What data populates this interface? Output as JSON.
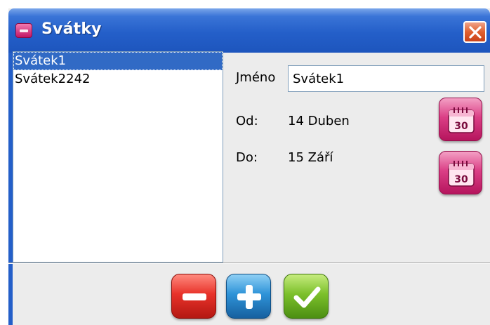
{
  "window": {
    "title": "Svátky",
    "close_label": "×"
  },
  "holidays": [
    {
      "name": "Svátek1",
      "selected": true
    },
    {
      "name": "Svátek2242",
      "selected": false
    }
  ],
  "details": {
    "name_label": "Jméno",
    "name_value": "Svátek1",
    "from_label": "Od:",
    "from_value": "14 Duben",
    "to_label": "Do:",
    "to_value": "15 Září",
    "calendar_icon_text": "30"
  },
  "icons": {
    "app": "holiday-app-icon",
    "close": "close-icon",
    "calendar": "calendar-icon",
    "remove": "minus-icon",
    "add": "plus-icon",
    "confirm": "checkmark-icon"
  },
  "colors": {
    "titlebar": "#245fc9",
    "selection": "#316ac5",
    "calendar_button": "#db3f86",
    "remove_button": "#e8322a",
    "add_button": "#2e93d8",
    "confirm_button": "#7cc02b"
  }
}
